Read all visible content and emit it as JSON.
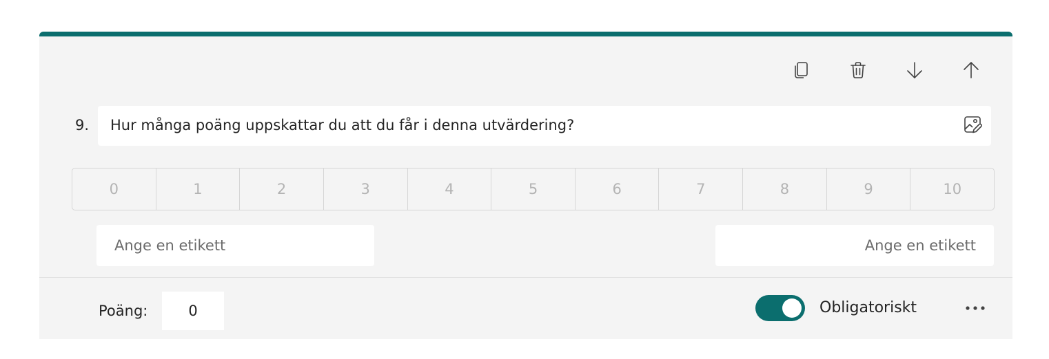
{
  "question": {
    "number": "9.",
    "text": "Hur många poäng uppskattar du att du får i denna utvärdering?"
  },
  "toolbar": {
    "icons": [
      "copy-icon",
      "trash-icon",
      "arrow-down-icon",
      "arrow-up-icon"
    ]
  },
  "scale": [
    "0",
    "1",
    "2",
    "3",
    "4",
    "5",
    "6",
    "7",
    "8",
    "9",
    "10"
  ],
  "labels": {
    "left_placeholder": "Ange en etikett",
    "right_placeholder": "Ange en etikett"
  },
  "footer": {
    "points_label": "Poäng:",
    "points_value": "0",
    "required_label": "Obligatoriskt",
    "required_on": true
  },
  "colors": {
    "accent": "#0b6e6e",
    "card_bg": "#f4f4f4"
  }
}
